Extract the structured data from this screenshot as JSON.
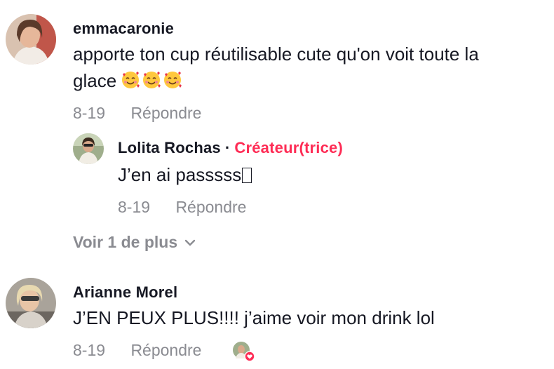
{
  "comments": [
    {
      "username": "emmacaronie",
      "text_line1": "apporte ton cup réutilisable cute qu'on voit toute la",
      "text_line2": "glace",
      "emojis": [
        "smiling-face-with-hearts",
        "smiling-face-with-hearts",
        "smiling-face-with-hearts"
      ],
      "date": "8-19",
      "reply_label": "Répondre",
      "replies": [
        {
          "username": "Lolita Rochas",
          "separator": "·",
          "badge": "Créateur(trice)",
          "text": "J’en ai passsss",
          "date": "8-19",
          "reply_label": "Répondre"
        }
      ],
      "view_more_label": "Voir 1 de plus"
    },
    {
      "username": "Arianne Morel",
      "text": "J’EN PEUX PLUS!!!! j’aime voir mon drink lol",
      "date": "8-19",
      "reply_label": "Répondre",
      "creator_liked": true
    }
  ],
  "colors": {
    "text": "#161823",
    "secondary": "#8a8b91",
    "accent": "#fe2c55"
  },
  "icons": {
    "view_more": "chevron-down-icon",
    "creator_like": "heart-badge-icon"
  }
}
